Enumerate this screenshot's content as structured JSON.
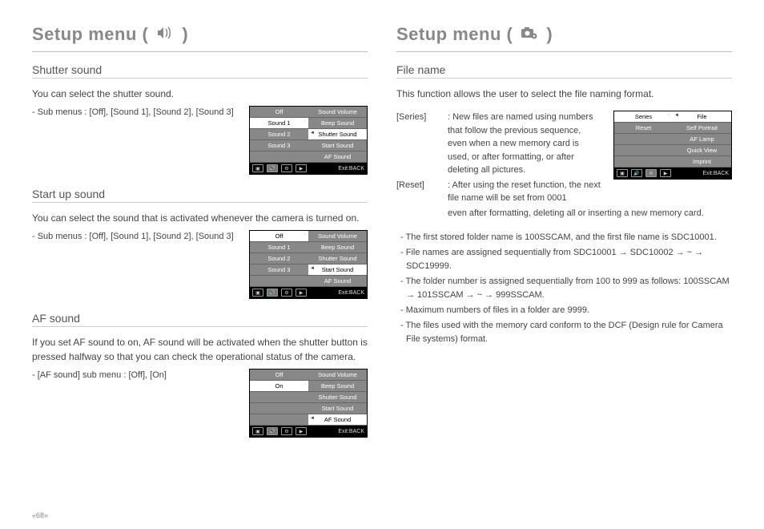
{
  "left": {
    "title_a": "Setup menu (",
    "title_b": ")",
    "shutter": {
      "heading": "Shutter sound",
      "desc": "You can select the shutter sound.",
      "sub": "- Sub menus : [Off], [Sound 1], [Sound 2], [Sound 3]",
      "menu_left": [
        "Off",
        "Sound 1",
        "Sound 2",
        "Sound 3"
      ],
      "menu_right": [
        "Sound Volume",
        "Beep Sound",
        "Shutter Sound",
        "Start Sound",
        "AF Sound"
      ],
      "selected_left": 1,
      "active_right": 2
    },
    "startup": {
      "heading": "Start up sound",
      "desc": "You can select the sound that is activated whenever the camera is turned on.",
      "sub": "- Sub menus : [Off], [Sound 1], [Sound 2], [Sound 3]",
      "menu_left": [
        "Off",
        "Sound 1",
        "Sound 2",
        "Sound 3"
      ],
      "menu_right": [
        "Sound Volume",
        "Beep Sound",
        "Shutter Sound",
        "Start Sound",
        "AF Sound"
      ],
      "selected_left": 0,
      "active_right": 3
    },
    "af": {
      "heading": "AF sound",
      "desc": "If you set AF sound to on, AF sound will be activated when the shutter button is pressed halfway so that you can check the operational status of the camera.",
      "sub": "- [AF sound] sub menu : [Off], [On]",
      "menu_left": [
        "Off",
        "On",
        "",
        "",
        ""
      ],
      "menu_right": [
        "Sound Volume",
        "Beep Sound",
        "Shutter Sound",
        "Start Sound",
        "AF Sound"
      ],
      "selected_left": 1,
      "active_right": 4
    },
    "exit": "Exit:BACK"
  },
  "right": {
    "title_a": "Setup menu (",
    "title_b": ")",
    "filename": {
      "heading": "File name",
      "desc": "This function allows the user to select the file naming format.",
      "series_term": "[Series]",
      "series_desc": ": New files are named using numbers that follow the previous sequence, even when a new memory card is used, or after formatting, or after deleting all pictures.",
      "reset_term": "[Reset]",
      "reset_desc_a": ": After using the reset function, the next file name will be set from 0001",
      "reset_desc_b": "even after formatting, deleting all or inserting a new memory card.",
      "menu_left": [
        "Series",
        "Reset"
      ],
      "menu_right": [
        "File",
        "Self Portrait",
        "AF Lamp",
        "Quick View",
        "Imprint"
      ],
      "selected_left": 0,
      "active_right": 0,
      "notes": [
        "The first stored folder name is 100SSCAM, and the first file name is SDC10001.",
        "File names are assigned sequentially from SDC10001 → SDC10002 → ~ → SDC19999.",
        "The folder number is assigned sequentially from 100 to 999 as follows: 100SSCAM → 101SSCAM → ~ → 999SSCAM.",
        "Maximum numbers of files in a folder are 9999.",
        "The files used with the memory card conform to the DCF (Design rule for Camera File systems) format."
      ]
    }
  },
  "page_number": "«68»"
}
